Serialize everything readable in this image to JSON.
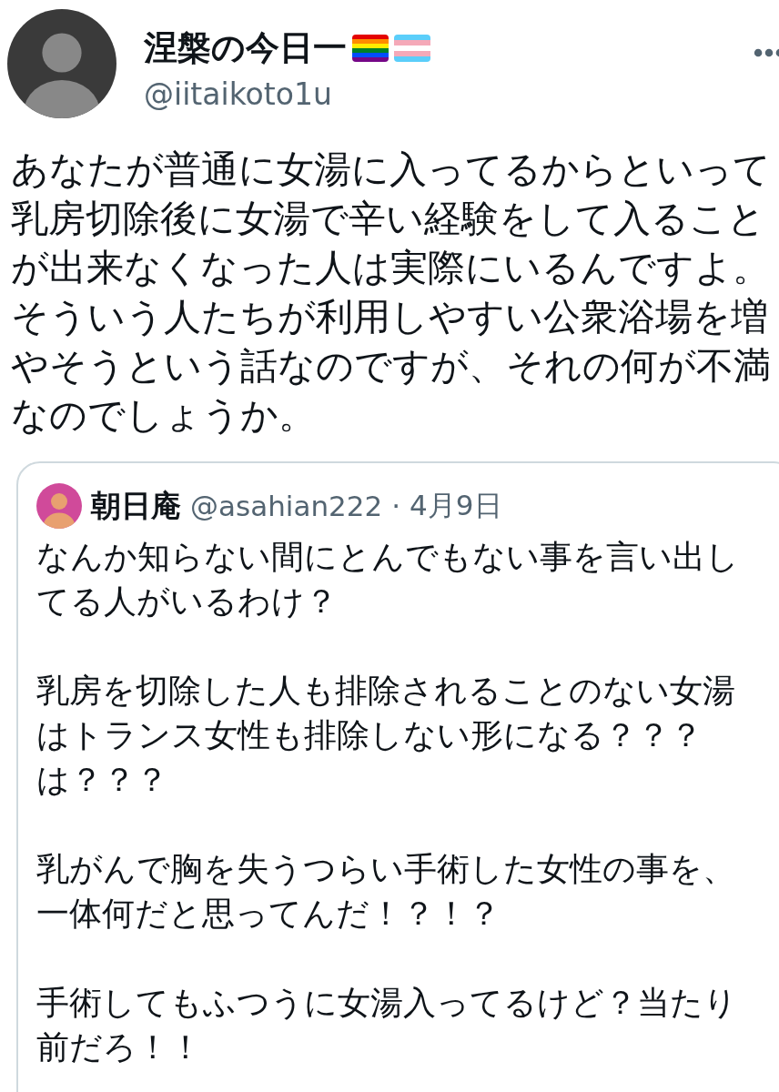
{
  "tweet": {
    "author": {
      "name": "涅槃の今日一",
      "handle": "@iitaikoto1u"
    },
    "text": "あなたが普通に女湯に入ってるからといって乳房切除後に女湯で辛い経験をして入ることが出来なくなった人は実際にいるんですよ。そういう人たちが利用しやすい公衆浴場を増やそうという話なのですが、それの何が不満なのでしょうか。",
    "quoted_tweet": {
      "author": {
        "name": "朝日庵",
        "handle": "@asahian222",
        "separator": "·",
        "date": "4月9日"
      },
      "paragraphs": [
        {
          "lines": [
            "なんか知らない間にとんでもない事を言い出してる人がいるわけ？"
          ]
        },
        {
          "lines": [
            "乳房を切除した人も排除されることのない女湯はトランス女性も排除しない形になる？？？",
            "は？？？"
          ]
        },
        {
          "lines": [
            "乳がんで胸を失うつらい手術した女性の事を、一体何だと思ってんだ！？！？"
          ]
        },
        {
          "lines": [
            "手術してもふつうに女湯入ってるけど？当たり前だろ！！"
          ]
        }
      ]
    }
  }
}
